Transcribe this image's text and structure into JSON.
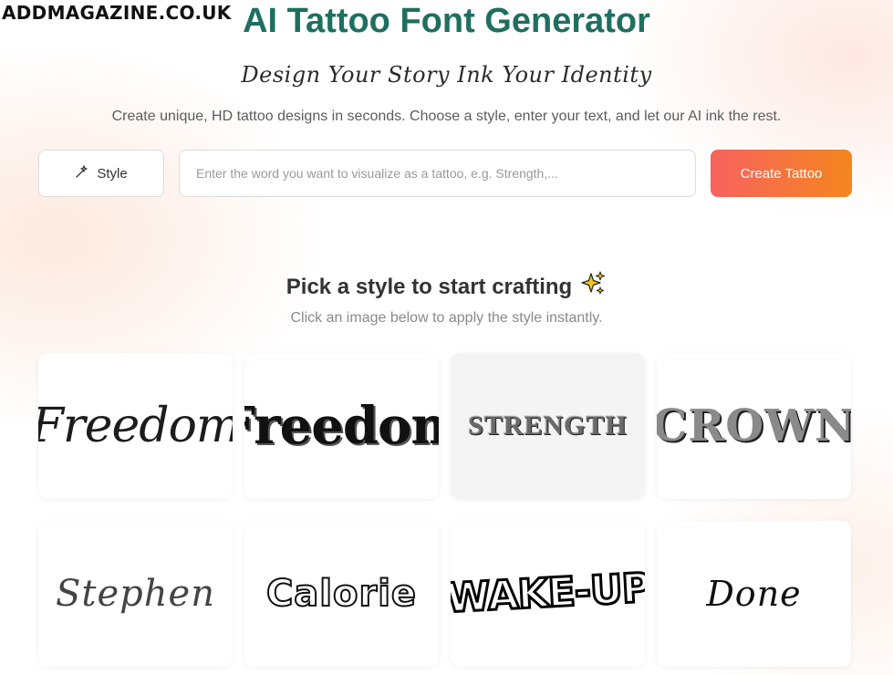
{
  "watermark": "ADDMAGAZINE.CO.UK",
  "header": {
    "title": "AI Tattoo Font Generator",
    "tagline": "Design Your Story Ink Your Identity",
    "description": "Create unique, HD tattoo designs in seconds. Choose a style, enter your text, and let our AI ink the rest."
  },
  "controls": {
    "style_button_label": "Style",
    "style_icon": "magic-wand-icon",
    "input_value": "",
    "input_placeholder": "Enter the word you want to visualize as a tattoo, e.g. Strength,...",
    "create_button_label": "Create Tattoo"
  },
  "gallery": {
    "title": "Pick a style to start crafting",
    "title_icon": "sparkles-icon",
    "subtitle": "Click an image below to apply the style instantly.",
    "styles": [
      {
        "text": "Freedom"
      },
      {
        "text": "Freedom"
      },
      {
        "text": "STRENGTH"
      },
      {
        "text": "CROWN"
      },
      {
        "text": "Stephen"
      },
      {
        "text": "Calorie"
      },
      {
        "text": "WAKE-UP"
      },
      {
        "text": "Done"
      }
    ]
  },
  "colors": {
    "title": "#1f6f5f",
    "create_button_start": "#f7625f",
    "create_button_end": "#f5861e",
    "sparkle": "#f5c518"
  }
}
